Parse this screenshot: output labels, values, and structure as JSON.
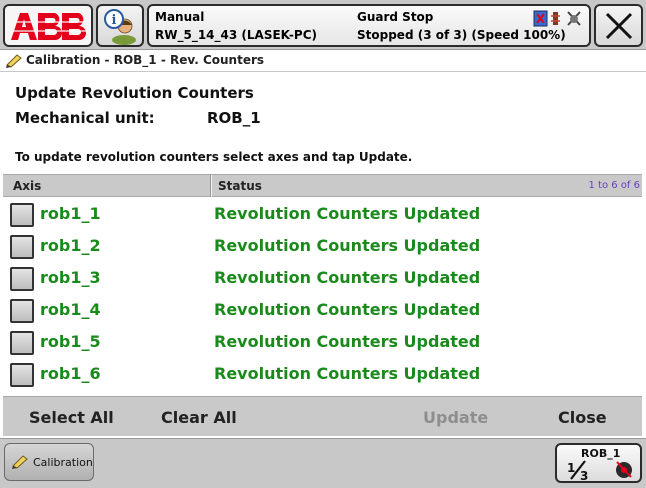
{
  "topbar": {
    "logo_text": "ABB",
    "mode": "Manual",
    "system_name": "RW_5_14_43 (LASEK-PC)",
    "controller_state": "Guard Stop",
    "program_state": "Stopped (3 of 3) (Speed 100%)"
  },
  "breadcrumb": {
    "text": "Calibration - ROB_1 - Rev. Counters"
  },
  "header": {
    "title": "Update Revolution Counters",
    "mech_unit_label": "Mechanical unit:",
    "mech_unit_value": "ROB_1",
    "instruction": "To update revolution counters select axes and tap Update."
  },
  "table": {
    "col_axis": "Axis",
    "col_status": "Status",
    "count_text": "1 to 6 of 6",
    "rows": [
      {
        "axis": "rob1_1",
        "status": "Revolution Counters Updated"
      },
      {
        "axis": "rob1_2",
        "status": "Revolution Counters Updated"
      },
      {
        "axis": "rob1_3",
        "status": "Revolution Counters Updated"
      },
      {
        "axis": "rob1_4",
        "status": "Revolution Counters Updated"
      },
      {
        "axis": "rob1_5",
        "status": "Revolution Counters Updated"
      },
      {
        "axis": "rob1_6",
        "status": "Revolution Counters Updated"
      }
    ]
  },
  "commands": {
    "select_all": "Select All",
    "clear_all": "Clear All",
    "update": "Update",
    "close": "Close"
  },
  "taskbar": {
    "task_label": "Calibration",
    "quickset_unit": "ROB_1",
    "quickset_ratio": "1/3"
  },
  "colors": {
    "abb_red": "#e2001a",
    "updated_green": "#1a8a1a",
    "count_purple": "#6a3fc0",
    "bar_gray": "#c9c9c9"
  },
  "icons": {
    "abb_menu": "abb-logo",
    "operator_window": "info-user-icon",
    "status_icons": [
      "motors-off-icon",
      "program-stop-icon",
      "guard-stop-icon"
    ],
    "close": "close-x-icon",
    "breadcrumb": "calibration-pencil-icon",
    "quickset": "quickset-icon"
  }
}
